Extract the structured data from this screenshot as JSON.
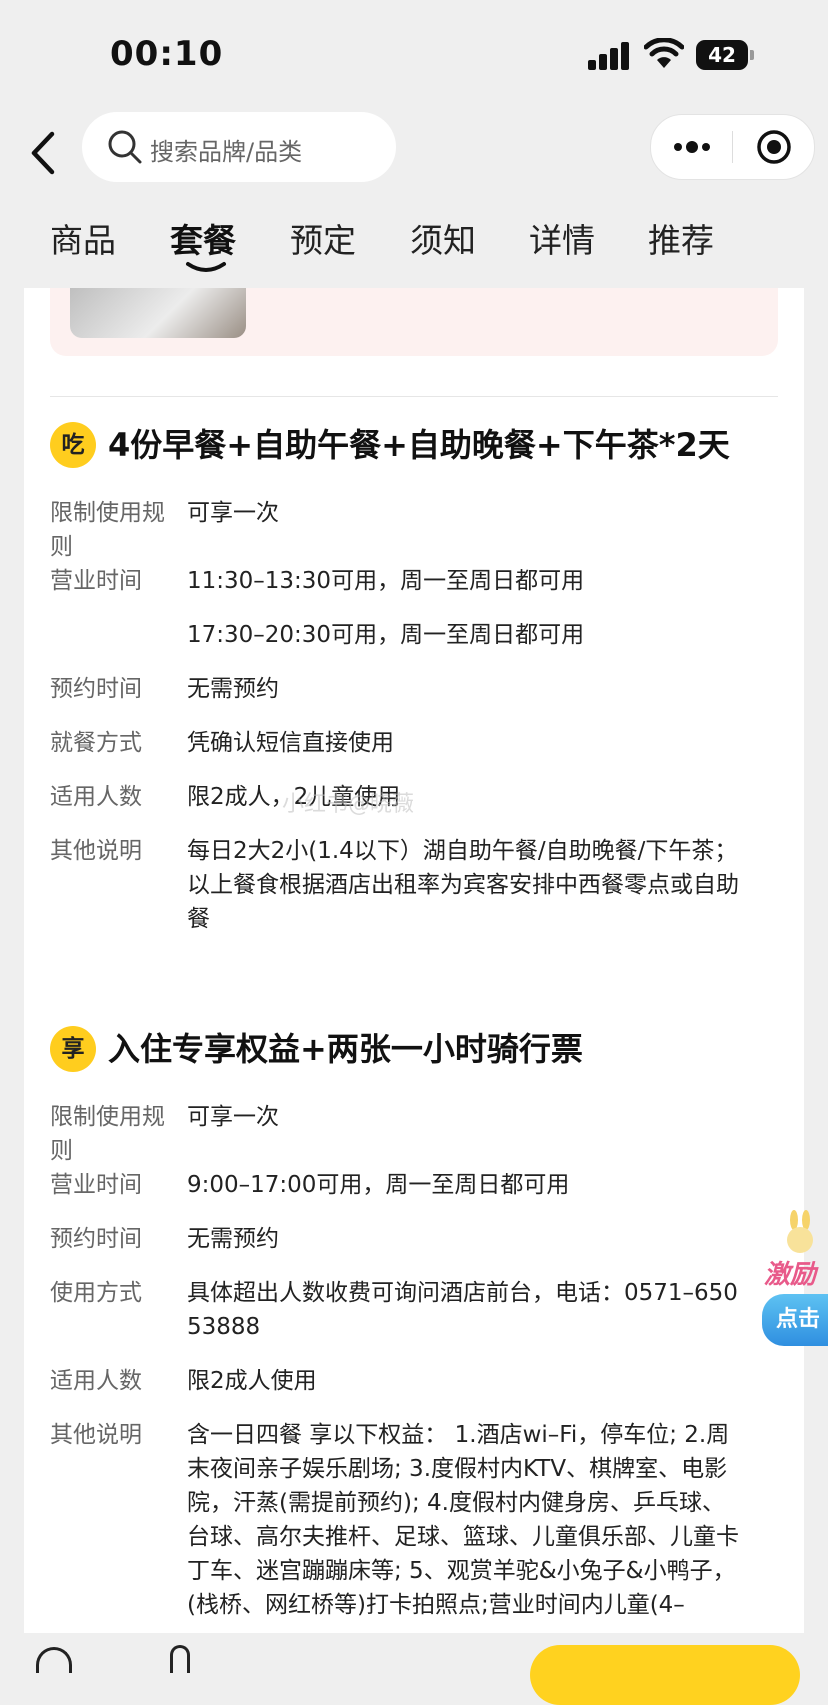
{
  "status_bar": {
    "time": "00:10",
    "battery": "42"
  },
  "search": {
    "placeholder": "搜索品牌/品类"
  },
  "tabs": [
    {
      "label": "商品"
    },
    {
      "label": "套餐"
    },
    {
      "label": "预定"
    },
    {
      "label": "须知"
    },
    {
      "label": "详情"
    },
    {
      "label": "推荐"
    }
  ],
  "active_tab": "套餐",
  "watermark": "小红书@晓薇",
  "packages": [
    {
      "badge": "吃",
      "title": "4份早餐+自助午餐+自助晚餐+下午茶*2天",
      "rows": [
        {
          "label": "限制使用规则",
          "value": "可享一次"
        },
        {
          "label": "营业时间",
          "value": "11:30–13:30可用，周一至周日都可用"
        },
        {
          "label": "",
          "value": "17:30–20:30可用，周一至周日都可用"
        },
        {
          "label": "预约时间",
          "value": "无需预约"
        },
        {
          "label": "就餐方式",
          "value": "凭确认短信直接使用"
        },
        {
          "label": "适用人数",
          "value": "限2成人，2儿童使用"
        },
        {
          "label": "其他说明",
          "value": "每日2大2小(1.4以下）湖自助午餐/自助晚餐/下午茶； 以上餐食根据酒店出租率为宾客安排中西餐零点或自助餐"
        }
      ]
    },
    {
      "badge": "享",
      "title": "入住专享权益+两张一小时骑行票",
      "rows": [
        {
          "label": "限制使用规则",
          "value": "可享一次"
        },
        {
          "label": "营业时间",
          "value": "9:00–17:00可用，周一至周日都可用"
        },
        {
          "label": "预约时间",
          "value": "无需预约"
        },
        {
          "label": "使用方式",
          "value": "具体超出人数收费可询问酒店前台，电话：0571–65053888"
        },
        {
          "label": "适用人数",
          "value": "限2成人使用"
        },
        {
          "label": "其他说明",
          "value": "含一日四餐 享以下权益： 1.酒店wi–Fi，停车位; 2.周末夜间亲子娱乐剧场; 3.度假村内KTV、棋牌室、电影院，汗蒸(需提前预约); 4.度假村内健身房、乒乓球、台球、高尔夫推杆、足球、篮球、儿童俱乐部、儿童卡丁车、迷宫蹦蹦床等; 5、观赏羊驼&小兔子&小鸭子，(栈桥、网红桥等)打卡拍照点;营业时间内儿童(4–"
        }
      ]
    }
  ],
  "float_widget": {
    "text": "激励",
    "button": "点击"
  }
}
